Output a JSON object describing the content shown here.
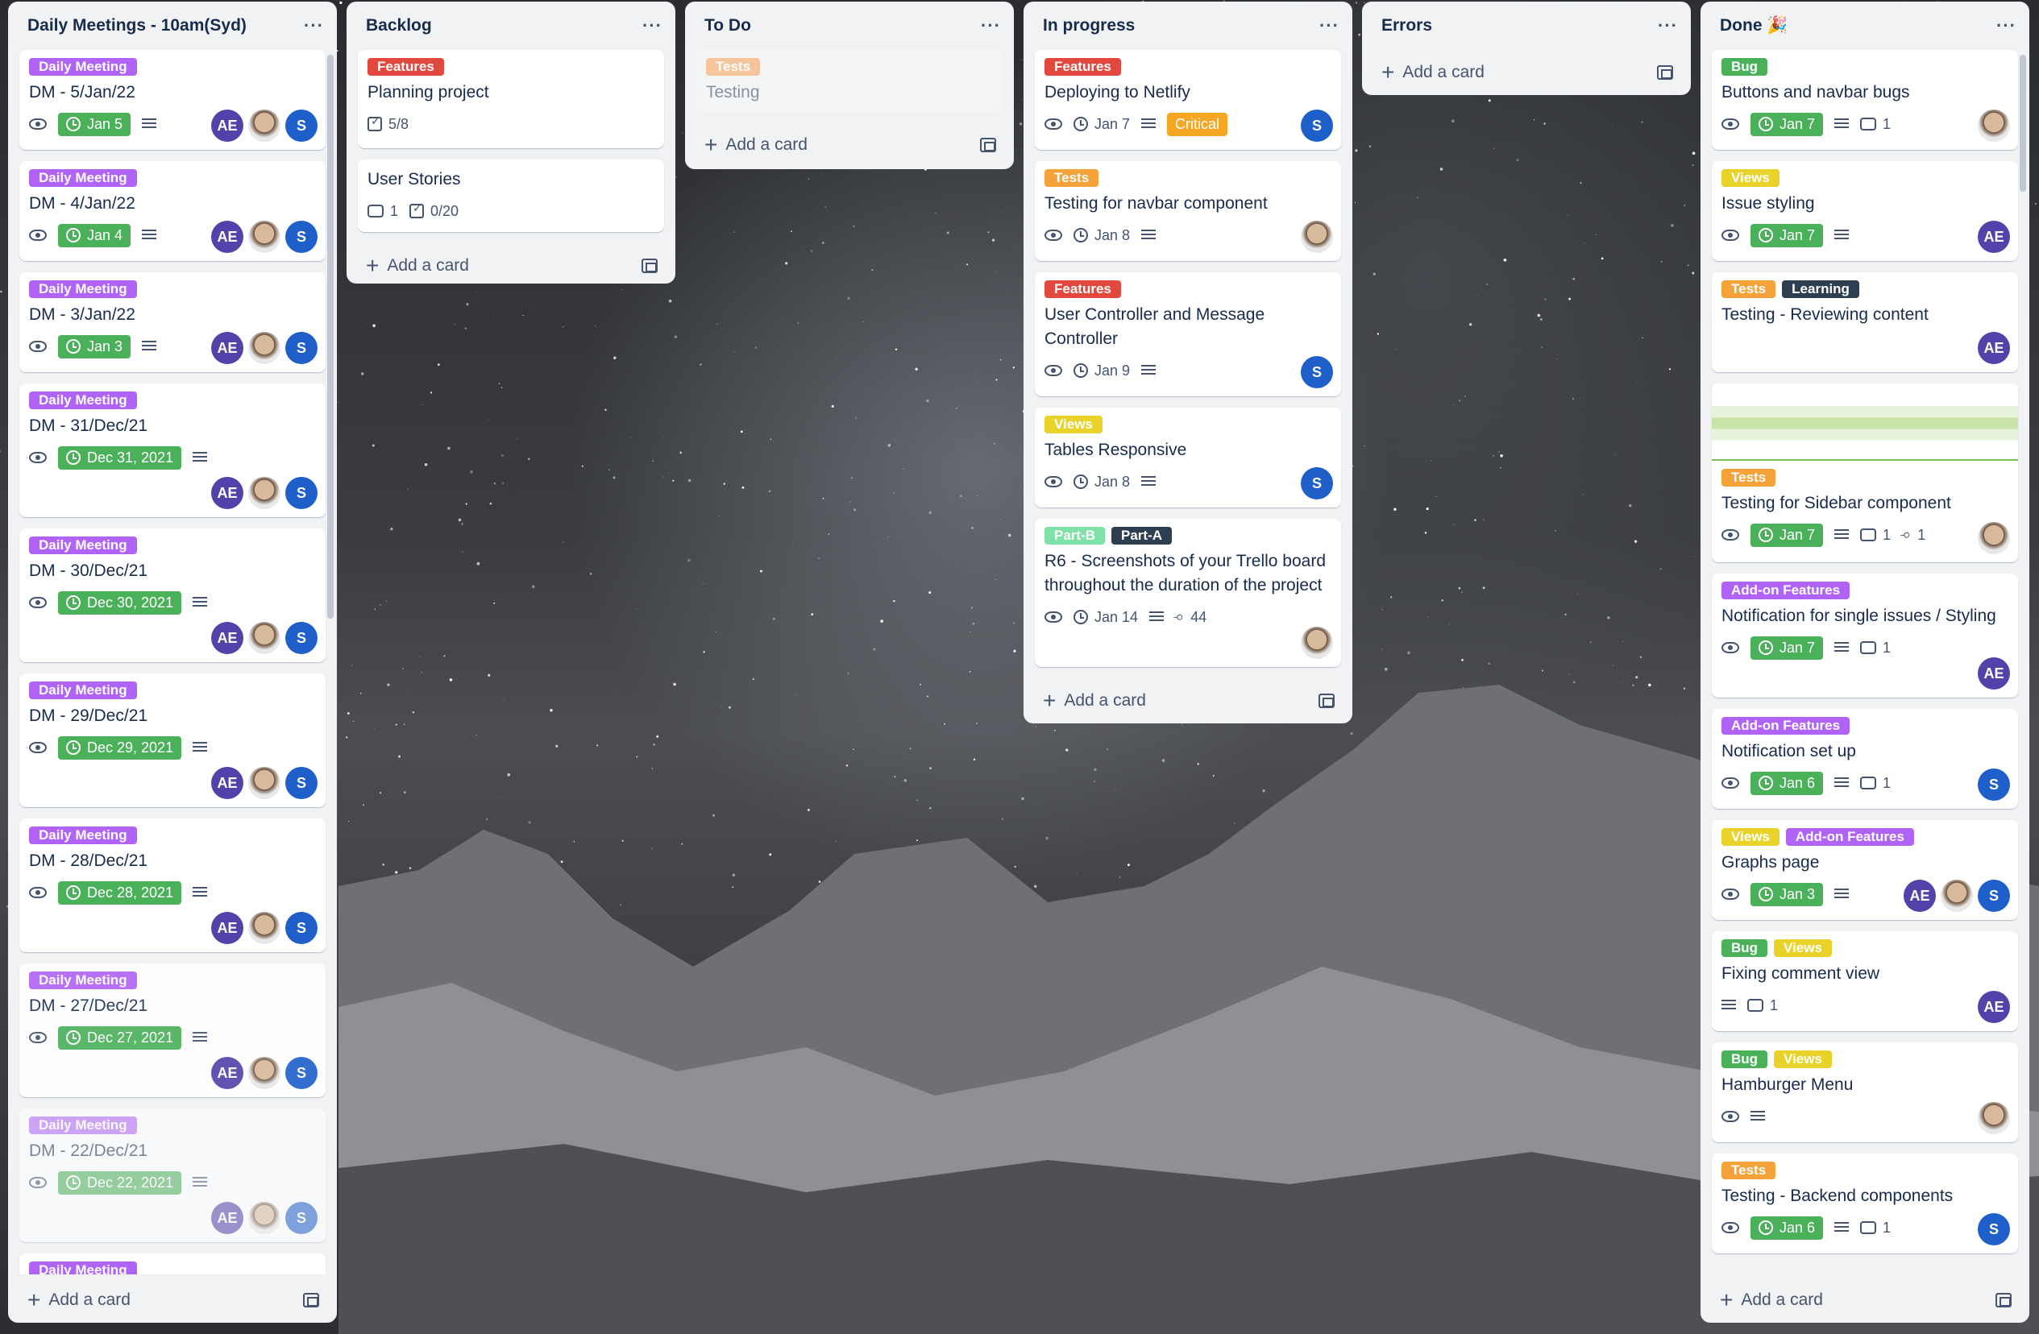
{
  "colors": {
    "purple": "#a855f7",
    "red": "#e2483d",
    "orange": "#f6a23b",
    "yellow": "#e9d32b",
    "green": "#4ab05a",
    "dark": "#2c3e50",
    "teal": "#7ee2a8"
  },
  "lists": [
    {
      "title": "Daily Meetings - 10am(Syd)",
      "add_label": "Add a card",
      "cards": [
        {
          "labels": [
            "Daily Meeting"
          ],
          "title": "DM - 5/Jan/22",
          "due": "Jan 5"
        },
        {
          "labels": [
            "Daily Meeting"
          ],
          "title": "DM - 4/Jan/22",
          "due": "Jan 4"
        },
        {
          "labels": [
            "Daily Meeting"
          ],
          "title": "DM - 3/Jan/22",
          "due": "Jan 3"
        },
        {
          "labels": [
            "Daily Meeting"
          ],
          "title": "DM - 31/Dec/21",
          "due": "Dec 31, 2021"
        },
        {
          "labels": [
            "Daily Meeting"
          ],
          "title": "DM - 30/Dec/21",
          "due": "Dec 30, 2021"
        },
        {
          "labels": [
            "Daily Meeting"
          ],
          "title": "DM - 29/Dec/21",
          "due": "Dec 29, 2021"
        },
        {
          "labels": [
            "Daily Meeting"
          ],
          "title": "DM - 28/Dec/21",
          "due": "Dec 28, 2021"
        },
        {
          "labels": [
            "Daily Meeting"
          ],
          "title": "DM - 27/Dec/21",
          "due": "Dec 27, 2021"
        },
        {
          "labels": [
            "Daily Meeting"
          ],
          "title": "DM - 22/Dec/21",
          "due": "Dec 22, 2021"
        },
        {
          "labels": [
            "Daily Meeting"
          ]
        }
      ],
      "avatars": [
        "AE",
        "S"
      ]
    },
    {
      "title": "Backlog",
      "add_label": "Add a card",
      "cards": [
        {
          "labels": [
            "Features"
          ],
          "title": "Planning project",
          "checklist": "5/8"
        },
        {
          "title": "User Stories",
          "comments": "1",
          "checklist": "0/20"
        }
      ]
    },
    {
      "title": "To Do",
      "add_label": "Add a card",
      "cards": [
        {
          "labels": [
            "Tests"
          ],
          "title": "Testing"
        }
      ]
    },
    {
      "title": "In progress",
      "add_label": "Add a card",
      "cards": [
        {
          "labels": [
            "Features"
          ],
          "title": "Deploying to Netlify",
          "date": "Jan 7",
          "custom": "Critical",
          "member": "S"
        },
        {
          "labels": [
            "Tests"
          ],
          "title": "Testing for navbar component",
          "date": "Jan 8"
        },
        {
          "labels": [
            "Features"
          ],
          "title": "User Controller and Message Controller",
          "date": "Jan 9",
          "member": "S"
        },
        {
          "labels": [
            "Views"
          ],
          "title": "Tables Responsive",
          "date": "Jan 8",
          "member": "S"
        },
        {
          "labels": [
            "Part-B",
            "Part-A"
          ],
          "title": "R6 - Screenshots of your Trello board throughout the duration of the project",
          "date": "Jan 14",
          "attachments": "44"
        }
      ]
    },
    {
      "title": "Errors",
      "add_label": "Add a card",
      "cards": []
    },
    {
      "title": "Done 🎉",
      "add_label": "Add a card",
      "cards": [
        {
          "labels": [
            "Bug"
          ],
          "title": "Buttons and navbar bugs",
          "due": "Jan 7",
          "comments": "1"
        },
        {
          "labels": [
            "Views"
          ],
          "title": "Issue styling",
          "due": "Jan 7",
          "member": "AE"
        },
        {
          "labels": [
            "Tests",
            "Learning"
          ],
          "title": "Testing - Reviewing content",
          "member": "AE"
        },
        {
          "labels": [
            "Tests"
          ],
          "title": "Testing for Sidebar component",
          "due": "Jan 7",
          "comments": "1",
          "attachments": "1"
        },
        {
          "labels": [
            "Add-on Features"
          ],
          "title": "Notification for single issues / Styling",
          "due": "Jan 7",
          "comments": "1",
          "member": "AE"
        },
        {
          "labels": [
            "Add-on Features"
          ],
          "title": "Notification set up",
          "due": "Jan 6",
          "comments": "1",
          "member": "S"
        },
        {
          "labels": [
            "Views",
            "Add-on Features"
          ],
          "title": "Graphs page",
          "due": "Jan 3"
        },
        {
          "labels": [
            "Bug",
            "Views"
          ],
          "title": "Fixing comment view",
          "comments": "1",
          "member": "AE"
        },
        {
          "labels": [
            "Bug",
            "Views"
          ],
          "title": "Hamburger Menu"
        },
        {
          "labels": [
            "Tests"
          ],
          "title": "Testing - Backend components",
          "due": "Jan 6",
          "comments": "1",
          "member": "S"
        }
      ]
    }
  ]
}
